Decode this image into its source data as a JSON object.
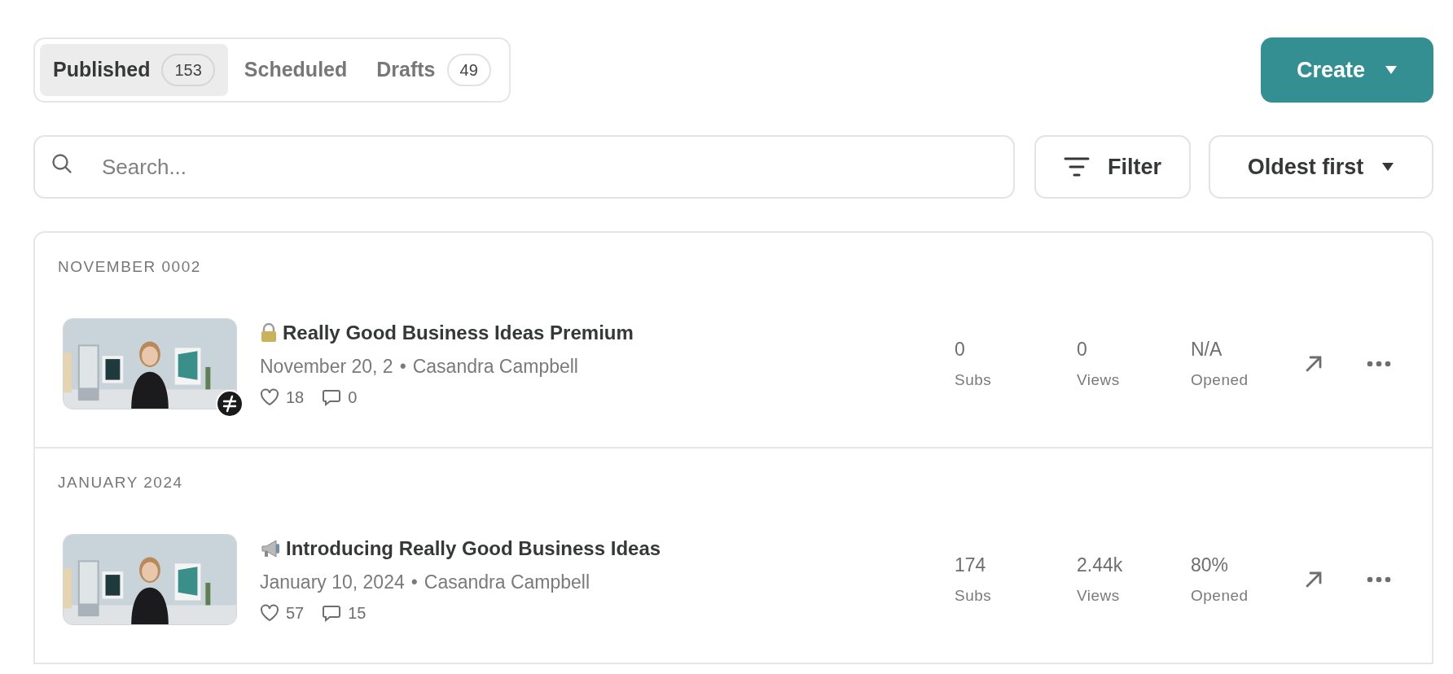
{
  "tabs": [
    {
      "label": "Published",
      "count": "153",
      "selected": true
    },
    {
      "label": "Scheduled",
      "selected": false
    },
    {
      "label": "Drafts",
      "count": "49",
      "selected": false
    }
  ],
  "create_button": {
    "label": "Create"
  },
  "search": {
    "placeholder": "Search..."
  },
  "filter_button": {
    "label": "Filter"
  },
  "sort_button": {
    "label": "Oldest first"
  },
  "sections": [
    {
      "heading": "NOVEMBER 0002",
      "posts": [
        {
          "paid": true,
          "title": "Really Good Business Ideas Premium",
          "date": "November 20, 2",
          "separator": "•",
          "author": "Casandra Campbell",
          "likes": "18",
          "comments": "0",
          "stats": [
            {
              "value": "0",
              "label": "Subs"
            },
            {
              "value": "0",
              "label": "Views"
            },
            {
              "value": "N/A",
              "label": "Opened"
            }
          ]
        }
      ]
    },
    {
      "heading": "JANUARY 2024",
      "posts": [
        {
          "paid": false,
          "title": "Introducing Really Good Business Ideas",
          "date": "January 10, 2024",
          "separator": "•",
          "author": "Casandra Campbell",
          "likes": "57",
          "comments": "15",
          "stats": [
            {
              "value": "174",
              "label": "Subs"
            },
            {
              "value": "2.44k",
              "label": "Views"
            },
            {
              "value": "80%",
              "label": "Opened"
            }
          ]
        }
      ]
    }
  ]
}
